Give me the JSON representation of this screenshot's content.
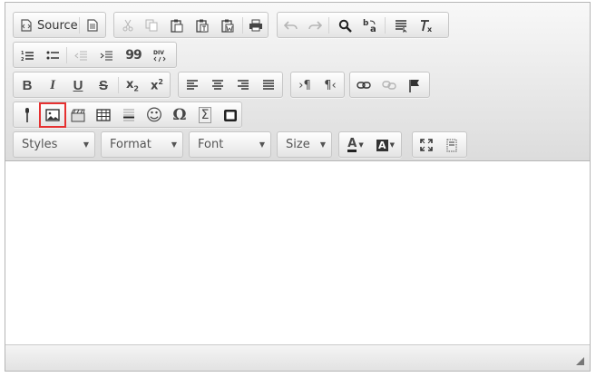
{
  "toolbar": {
    "source_label": "Source",
    "styles_label": "Styles",
    "format_label": "Format",
    "font_label": "Font",
    "size_label": "Size",
    "bold_glyph": "B",
    "italic_glyph": "I",
    "underline_glyph": "U",
    "strike_glyph": "S",
    "omega_glyph": "Ω",
    "sigma_glyph": "Σ",
    "smiley_glyph": "☺",
    "quote_glyph": "99"
  },
  "highlight": {
    "selected_button": "image-button",
    "color": "#e53030"
  }
}
